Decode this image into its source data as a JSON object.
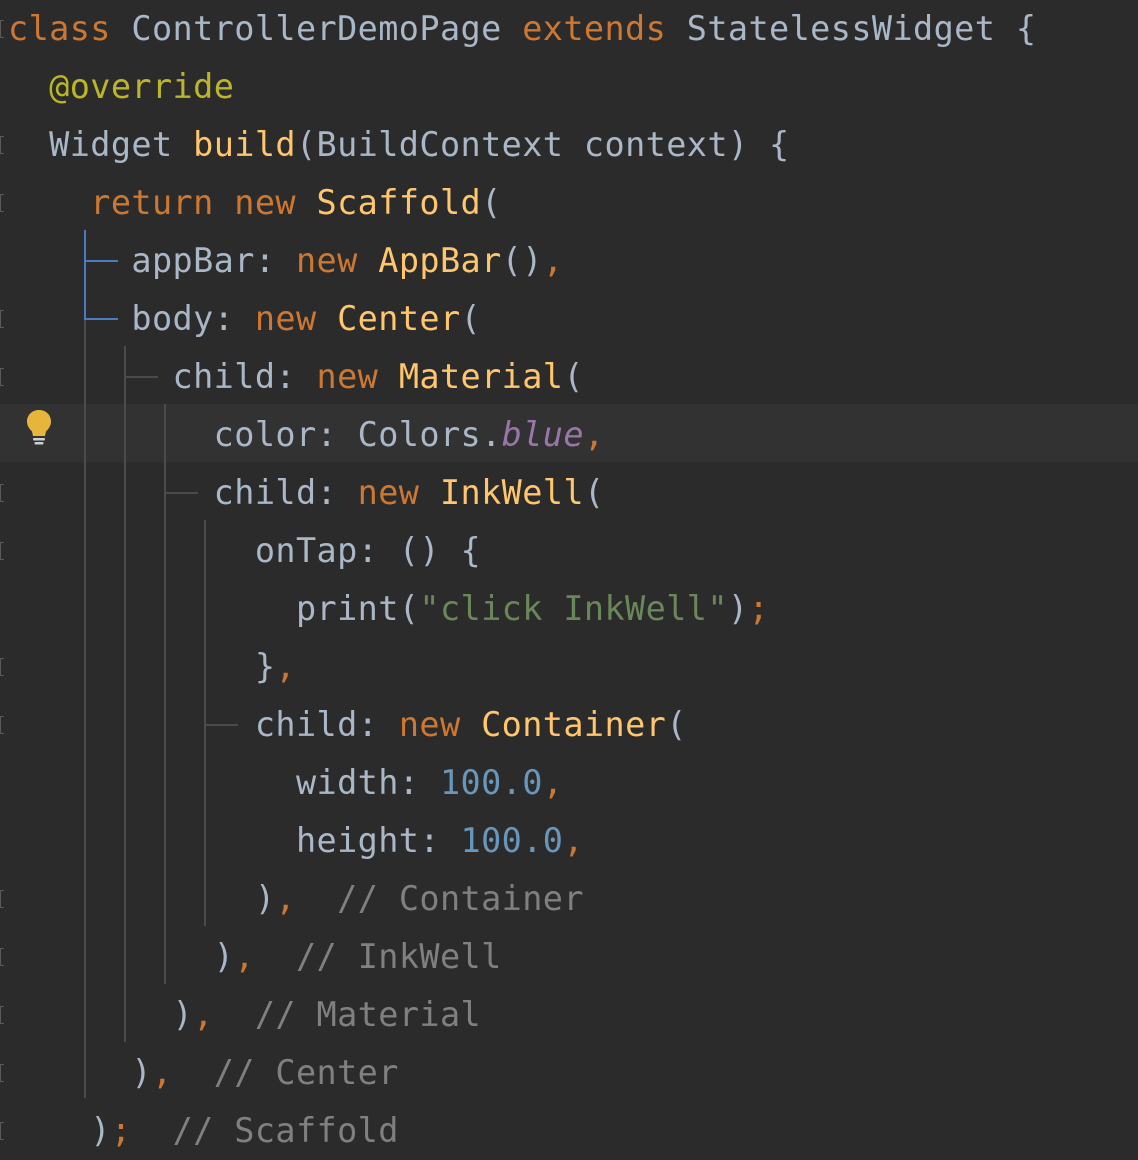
{
  "editor": {
    "lines": [
      [
        {
          "t": "class",
          "c": "kw"
        },
        {
          "t": " ControllerDemoPage ",
          "c": "pl"
        },
        {
          "t": "extends",
          "c": "kw"
        },
        {
          "t": " StatelessWidget {",
          "c": "pl"
        }
      ],
      [
        {
          "t": "  ",
          "c": "pl"
        },
        {
          "t": "@override",
          "c": "ann"
        }
      ],
      [
        {
          "t": "  Widget ",
          "c": "pl"
        },
        {
          "t": "build",
          "c": "cls"
        },
        {
          "t": "(BuildContext context) {",
          "c": "pl"
        }
      ],
      [
        {
          "t": "    ",
          "c": "pl"
        },
        {
          "t": "return new ",
          "c": "kw"
        },
        {
          "t": "Scaffold",
          "c": "cls"
        },
        {
          "t": "(",
          "c": "pl"
        }
      ],
      [
        {
          "t": "      appBar: ",
          "c": "pl"
        },
        {
          "t": "new ",
          "c": "kw"
        },
        {
          "t": "AppBar",
          "c": "cls"
        },
        {
          "t": "()",
          "c": "pl"
        },
        {
          "t": ",",
          "c": "kw"
        }
      ],
      [
        {
          "t": "      body: ",
          "c": "pl"
        },
        {
          "t": "new ",
          "c": "kw"
        },
        {
          "t": "Center",
          "c": "cls"
        },
        {
          "t": "(",
          "c": "pl"
        }
      ],
      [
        {
          "t": "        child: ",
          "c": "pl"
        },
        {
          "t": "new ",
          "c": "kw"
        },
        {
          "t": "Material",
          "c": "cls"
        },
        {
          "t": "(",
          "c": "pl"
        }
      ],
      [
        {
          "t": "          color: Colors.",
          "c": "pl"
        },
        {
          "t": "blue",
          "c": "fld"
        },
        {
          "t": ",",
          "c": "kw"
        }
      ],
      [
        {
          "t": "          child: ",
          "c": "pl"
        },
        {
          "t": "new ",
          "c": "kw"
        },
        {
          "t": "InkWell",
          "c": "cls"
        },
        {
          "t": "(",
          "c": "pl"
        }
      ],
      [
        {
          "t": "            onTap: () {",
          "c": "pl"
        }
      ],
      [
        {
          "t": "              print(",
          "c": "pl"
        },
        {
          "t": "\"click InkWell\"",
          "c": "str"
        },
        {
          "t": ")",
          "c": "pl"
        },
        {
          "t": ";",
          "c": "kw"
        }
      ],
      [
        {
          "t": "            }",
          "c": "pl"
        },
        {
          "t": ",",
          "c": "kw"
        }
      ],
      [
        {
          "t": "            child: ",
          "c": "pl"
        },
        {
          "t": "new ",
          "c": "kw"
        },
        {
          "t": "Container",
          "c": "cls"
        },
        {
          "t": "(",
          "c": "pl"
        }
      ],
      [
        {
          "t": "              width: ",
          "c": "pl"
        },
        {
          "t": "100.0",
          "c": "num"
        },
        {
          "t": ",",
          "c": "kw"
        }
      ],
      [
        {
          "t": "              height: ",
          "c": "pl"
        },
        {
          "t": "100.0",
          "c": "num"
        },
        {
          "t": ",",
          "c": "kw"
        }
      ],
      [
        {
          "t": "            )",
          "c": "pl"
        },
        {
          "t": ",  ",
          "c": "kw"
        },
        {
          "t": "// Container",
          "c": "cmt"
        }
      ],
      [
        {
          "t": "          )",
          "c": "pl"
        },
        {
          "t": ",  ",
          "c": "kw"
        },
        {
          "t": "// InkWell",
          "c": "cmt"
        }
      ],
      [
        {
          "t": "        )",
          "c": "pl"
        },
        {
          "t": ",  ",
          "c": "kw"
        },
        {
          "t": "// Material",
          "c": "cmt"
        }
      ],
      [
        {
          "t": "      )",
          "c": "pl"
        },
        {
          "t": ",  ",
          "c": "kw"
        },
        {
          "t": "// Center",
          "c": "cmt"
        }
      ],
      [
        {
          "t": "    )",
          "c": "pl"
        },
        {
          "t": ";  ",
          "c": "kw"
        },
        {
          "t": "// Scaffold",
          "c": "cmt"
        }
      ]
    ],
    "caret_line_index": 7,
    "intention_icon": "lightbulb-icon"
  },
  "colors": {
    "background": "#2b2b2b",
    "caret_line": "#323232",
    "keyword": "#cc7832",
    "class_name": "#ffc66d",
    "annotation": "#bbb529",
    "string": "#6a8759",
    "number": "#6897bb",
    "comment": "#808080",
    "field": "#9876aa",
    "plain": "#a9b7c6",
    "bulb": "#e8b53c"
  }
}
